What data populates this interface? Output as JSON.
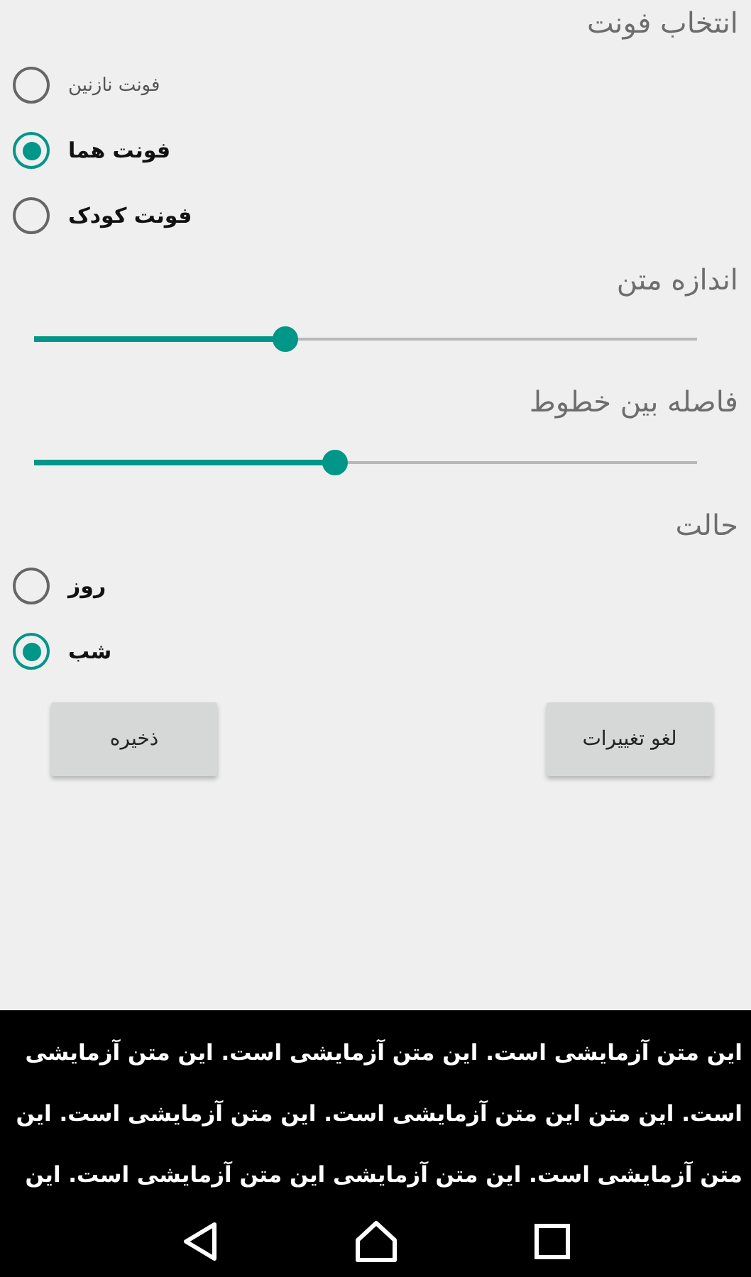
{
  "font_section": {
    "title": "انتخاب فونت",
    "options": [
      {
        "label": "فونت نازنین",
        "selected": false
      },
      {
        "label": "فونت هما",
        "selected": true
      },
      {
        "label": "فونت کودک",
        "selected": false
      }
    ]
  },
  "text_size": {
    "title": "اندازه متن",
    "level": 0.38
  },
  "line_spacing": {
    "title": "فاصله بین خطوط",
    "level": 0.455
  },
  "mode_section": {
    "title": "حالت",
    "options": [
      {
        "label": "روز",
        "selected": false
      },
      {
        "label": "شب",
        "selected": true
      }
    ]
  },
  "buttons": [
    {
      "label": "لغو تغییرات"
    },
    {
      "label": "ذخیره"
    }
  ],
  "preview": {
    "lines": [
      "این متن آزمایشی است. این متن آزمایشی است. این متن آزمایشی",
      "است. این متن این متن آزمایشی است. این متن آزمایشی است. این",
      "متن آزمایشی است. این متن آزمایشی این متن آزمایشی است. این"
    ]
  }
}
